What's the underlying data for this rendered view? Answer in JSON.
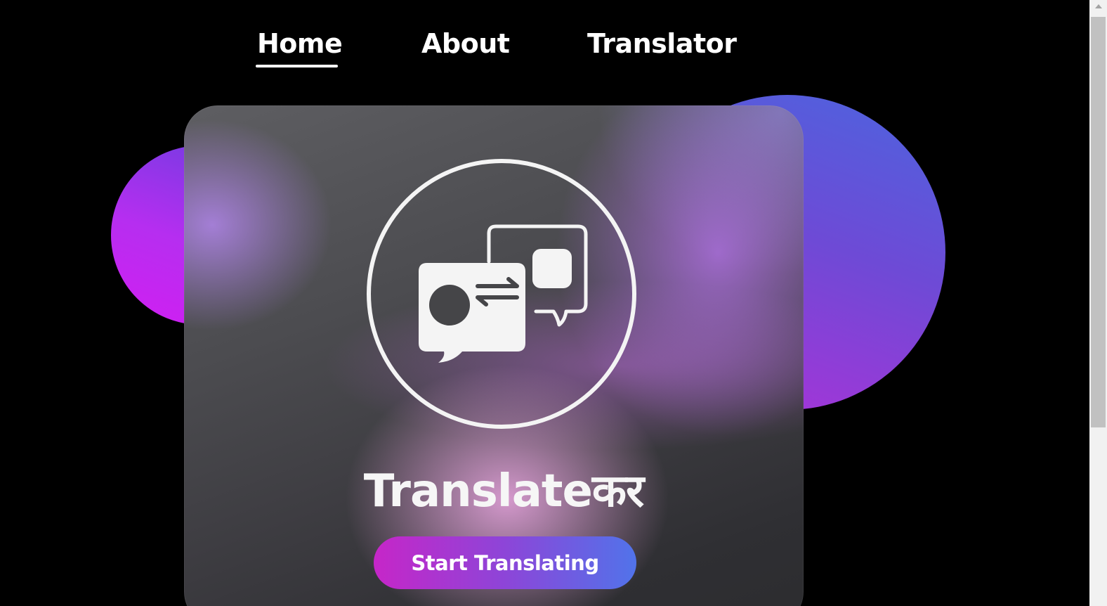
{
  "nav": {
    "items": [
      {
        "label": "Home",
        "active": true
      },
      {
        "label": "About",
        "active": false
      },
      {
        "label": "Translator",
        "active": false
      }
    ]
  },
  "hero": {
    "logo_icon": "translate-chat-bubbles-icon",
    "brand": "Translateकर",
    "cta_label": "Start Translating"
  },
  "colors": {
    "background": "#000000",
    "accent_pink": "#c626c8",
    "accent_purple": "#8d45d8",
    "accent_blue": "#5173ea"
  }
}
